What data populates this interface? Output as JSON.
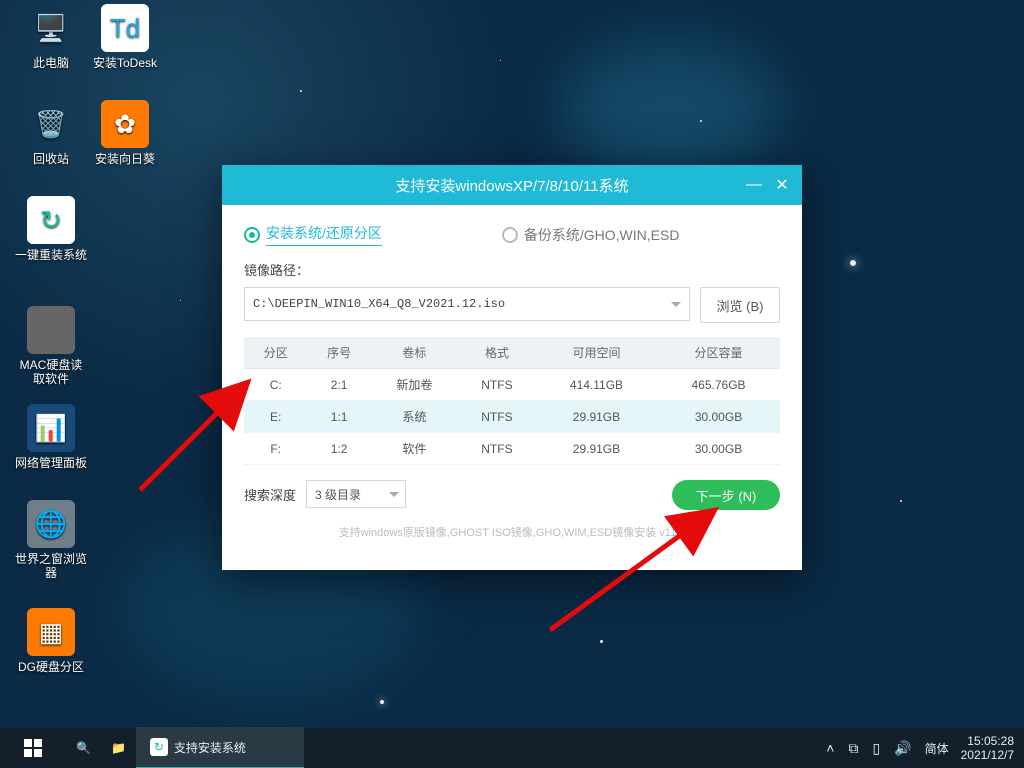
{
  "desktop_icons": [
    {
      "label": "此电脑",
      "bg": "transparent",
      "glyph": "🖥️"
    },
    {
      "label": "安装ToDesk",
      "bg": "#fff",
      "glyph": "Td",
      "color": "#1fa8e0"
    },
    {
      "label": "回收站",
      "bg": "transparent",
      "glyph": "🗑️"
    },
    {
      "label": "安装向日葵",
      "bg": "#ff7a00",
      "glyph": "✿"
    },
    {
      "label": "一键重装系统",
      "bg": "#fff",
      "glyph": "↻",
      "color": "#1abc9c"
    },
    {
      "label": "MAC硬盘读取软件",
      "bg": "#666",
      "glyph": ""
    },
    {
      "label": "网络管理面板",
      "bg": "#1a4a7a",
      "glyph": "📊"
    },
    {
      "label": "世界之窗浏览器",
      "bg": "#6f7f8a",
      "glyph": "🌐"
    },
    {
      "label": "DG硬盘分区",
      "bg": "#ff7a00",
      "glyph": "▦"
    }
  ],
  "window": {
    "title": "支持安装windowsXP/7/8/10/11系统",
    "tab_install": "安装系统/还原分区",
    "tab_backup": "备份系统/GHO,WIN,ESD",
    "path_label": "镜像路径：",
    "path_value": "C:\\DEEPIN_WIN10_X64_Q8_V2021.12.iso",
    "browse": "浏览 (B)",
    "columns": [
      "分区",
      "序号",
      "卷标",
      "格式",
      "可用空间",
      "分区容量"
    ],
    "rows": [
      {
        "p": "C:",
        "n": "2:1",
        "v": "新加卷",
        "f": "NTFS",
        "free": "414.11GB",
        "cap": "465.76GB",
        "sel": false
      },
      {
        "p": "E:",
        "n": "1:1",
        "v": "系统",
        "f": "NTFS",
        "free": "29.91GB",
        "cap": "30.00GB",
        "sel": true
      },
      {
        "p": "F:",
        "n": "1:2",
        "v": "软件",
        "f": "NTFS",
        "free": "29.91GB",
        "cap": "30.00GB",
        "sel": false
      }
    ],
    "search_label": "搜索深度",
    "search_value": "3 级目录",
    "next": "下一步 (N)",
    "footer": "支持windows原版镜像,GHOST ISO镜像,GHO,WIM,ESD镜像安装  v11.0"
  },
  "taskbar": {
    "task": "支持安装系统",
    "ime": "简体",
    "time": "15:05:28",
    "date": "2021/12/7"
  }
}
